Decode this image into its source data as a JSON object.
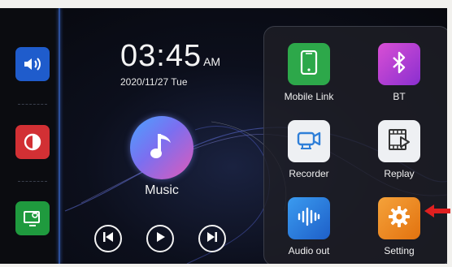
{
  "clock": {
    "time": "03:45",
    "ampm": "AM",
    "date": "2020/11/27 Tue"
  },
  "sidebar": {
    "items": [
      {
        "icon": "volume-icon",
        "color": "#1f5ccc"
      },
      {
        "icon": "brightness-icon",
        "color": "#d23034"
      },
      {
        "icon": "screen-off-icon",
        "color": "#1f9a3e"
      }
    ]
  },
  "music": {
    "label": "Music"
  },
  "controls": [
    "previous-icon",
    "play-icon",
    "next-icon"
  ],
  "apps": [
    {
      "label": "Mobile Link",
      "icon": "phone-icon",
      "color": "#2da84a"
    },
    {
      "label": "BT",
      "icon": "bluetooth-icon",
      "color": "#c13ad2"
    },
    {
      "label": "Recorder",
      "icon": "camera-icon",
      "color": "#eef0f3"
    },
    {
      "label": "Replay",
      "icon": "film-play-icon",
      "color": "#eef0f3"
    },
    {
      "label": "Audio out",
      "icon": "audio-wave-icon",
      "color": "#2a7fe0"
    },
    {
      "label": "Setting",
      "icon": "gear-icon",
      "color": "#ee8a1c"
    }
  ],
  "annotation": {
    "icon": "red-arrow-icon",
    "color": "#e02020"
  }
}
